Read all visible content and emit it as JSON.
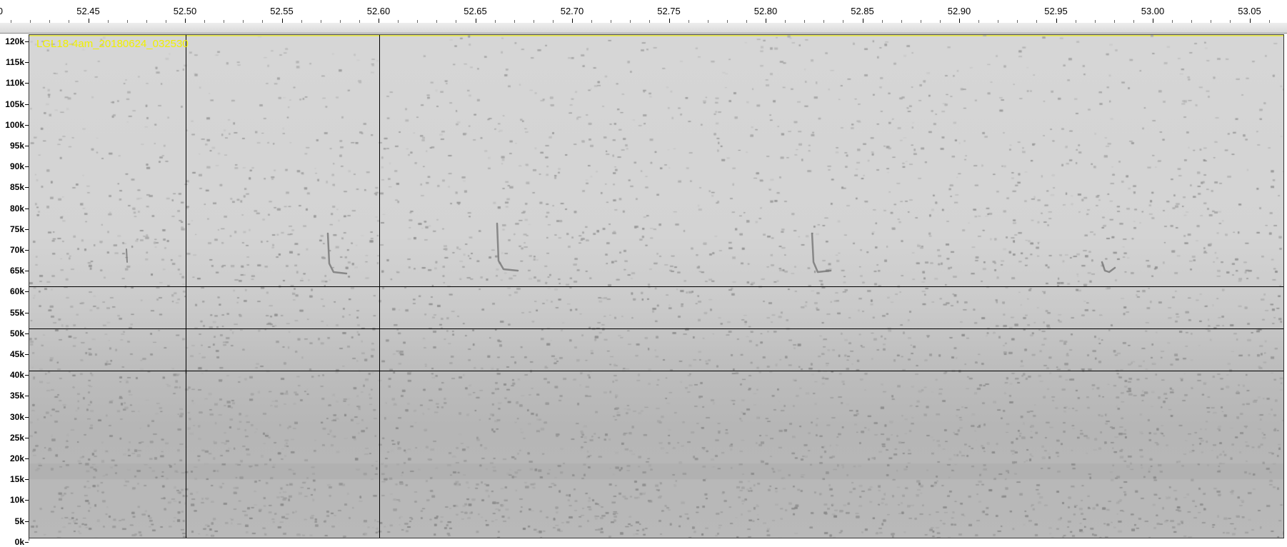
{
  "window": {
    "track_name": "LGL18-4am_20180624_032530"
  },
  "timeline": {
    "first_partial_label": "0",
    "labels": [
      "52.45",
      "52.50",
      "52.55",
      "52.60",
      "52.65",
      "52.70",
      "52.75",
      "52.80",
      "52.85",
      "52.90",
      "52.95",
      "53.00",
      "53.05"
    ]
  },
  "frequency_axis": {
    "labels": [
      "120k",
      "115k",
      "110k",
      "105k",
      "100k",
      "95k",
      "90k",
      "85k",
      "80k",
      "75k",
      "70k",
      "65k",
      "60k",
      "55k",
      "50k",
      "45k",
      "40k",
      "35k",
      "30k",
      "25k",
      "20k",
      "15k",
      "10k",
      "5k",
      "0k"
    ]
  },
  "grid": {
    "selection_lines_time": [
      52.5,
      52.6
    ],
    "horizontal_lines_khz": [
      60,
      50,
      40
    ]
  },
  "colors": {
    "background": "#d3d3d3",
    "track_name": "#f0f000",
    "call_marks": "#7a7a7a"
  }
}
